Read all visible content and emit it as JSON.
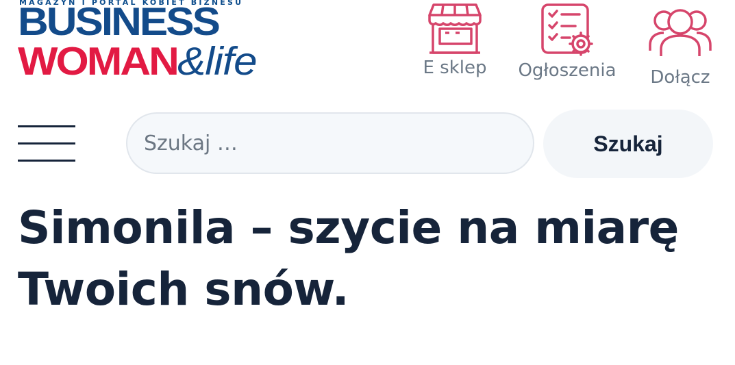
{
  "header": {
    "logo": {
      "tagline": "MAGAZYN I PORTAL KOBIET BIZNESU",
      "line1": "BUSINESS",
      "line2_a": "WOMAN",
      "line2_b": "&life"
    },
    "links": [
      {
        "label": "E sklep",
        "icon": "shop-icon"
      },
      {
        "label": "Ogłoszenia",
        "icon": "checklist-gear-icon"
      },
      {
        "label": "Dołącz",
        "icon": "people-group-icon"
      }
    ]
  },
  "search": {
    "menu_icon": "hamburger-menu-icon",
    "placeholder": "Szukaj …",
    "value": "",
    "button_label": "Szukaj"
  },
  "article": {
    "title": "Simonila – szycie na miarę Twoich snów."
  },
  "colors": {
    "brand_blue": "#134b8a",
    "brand_red": "#e21a43",
    "icon_pink": "#d6456b",
    "text_dark": "#16243a",
    "muted_text": "#6b7886",
    "input_bg": "#f5f8fb"
  }
}
